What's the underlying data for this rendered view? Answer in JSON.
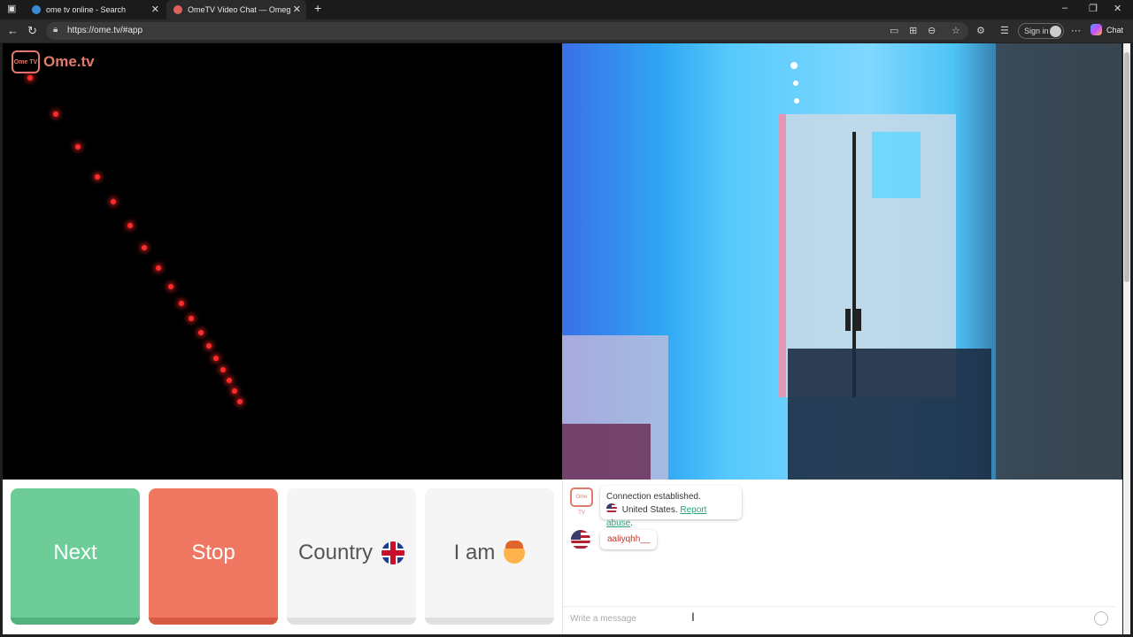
{
  "browser": {
    "tabs": [
      {
        "label": "ome tv online - Search",
        "active": false
      },
      {
        "label": "OmeTV Video Chat — Omeg",
        "active": true
      }
    ],
    "url": "https://ome.tv/#app",
    "sign_in_label": "Sign in",
    "chat_label": "Chat"
  },
  "app": {
    "logo_text": "Ome.tv",
    "logo_badge": "Ome TV",
    "buttons": {
      "next": "Next",
      "stop": "Stop",
      "country": "Country",
      "iam": "I am"
    },
    "chat": {
      "system_badge": "Ome TV",
      "system_message": "Connection established.",
      "country": "United States.",
      "report_link": "Report abuse",
      "report_suffix": ".",
      "stranger_name": "aaliyqhh__",
      "input_placeholder": "Write a message"
    }
  },
  "colors": {
    "next": "#6dcc98",
    "stop": "#f07762",
    "brand": "#e07a6b",
    "link": "#2aa37a"
  }
}
